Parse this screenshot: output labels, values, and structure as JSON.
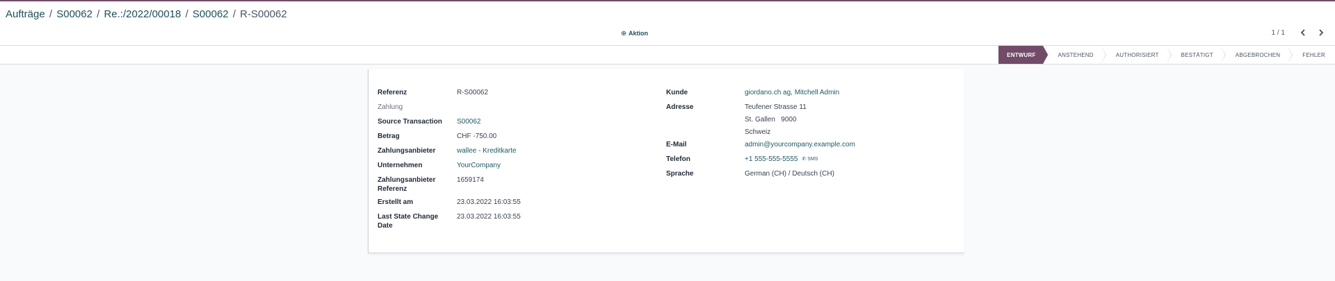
{
  "breadcrumb": {
    "items": [
      "Aufträge",
      "S00062",
      "Re.:/2022/00018",
      "S00062"
    ],
    "current": "R-S00062",
    "separator": "/"
  },
  "actions": {
    "label": "Aktion"
  },
  "pager": {
    "value": "1 / 1"
  },
  "statusbar": {
    "stages": [
      "ENTWURF",
      "ANSTEHEND",
      "AUTHORISIERT",
      "BESTÄTIGT",
      "ABGEBROCHEN",
      "FEHLER"
    ],
    "active": "ENTWURF"
  },
  "form": {
    "left": [
      {
        "label": "Referenz",
        "value": "R-S00062"
      },
      {
        "label": "Zahlung",
        "value": ""
      },
      {
        "label": "Source Transaction",
        "value": "S00062"
      },
      {
        "label": "Betrag",
        "value": "CHF -750.00"
      },
      {
        "label": "Zahlungsanbieter",
        "value": "wallee - Kreditkarte"
      },
      {
        "label": "Unternehmen",
        "value": "YourCompany"
      },
      {
        "label": "Zahlungsanbieter Referenz",
        "label_line1": "Zahlungsanbieter",
        "label_line2": "Referenz",
        "value": "1659174"
      },
      {
        "label": "Erstellt am",
        "value": "23.03.2022 16:03:55"
      },
      {
        "label": "Last State Change Date",
        "label_line1": "Last State Change",
        "label_line2": "Date",
        "value": "23.03.2022 16:03:55"
      }
    ],
    "right": {
      "kunde": {
        "label": "Kunde",
        "value": "giordano.ch ag, Mitchell Admin"
      },
      "adresse": {
        "label": "Adresse",
        "street": "Teufener Strasse 11",
        "city": "St. Gallen",
        "zip": "9000",
        "country": "Schweiz"
      },
      "email": {
        "label": "E-Mail",
        "value": "admin@yourcompany.example.com"
      },
      "telefon": {
        "label": "Telefon",
        "value": "+1 555-555-5555",
        "sms": "SMS"
      },
      "sprache": {
        "label": "Sprache",
        "value": "German (CH) / Deutsch (CH)"
      }
    }
  },
  "colors": {
    "brand": "#714b67",
    "link": "#1f5a63",
    "background": "#f9fafb"
  },
  "icons": {
    "actions": "gear-icon",
    "prev": "chevron-left-icon",
    "next": "chevron-right-icon",
    "sms": "phone-icon"
  }
}
